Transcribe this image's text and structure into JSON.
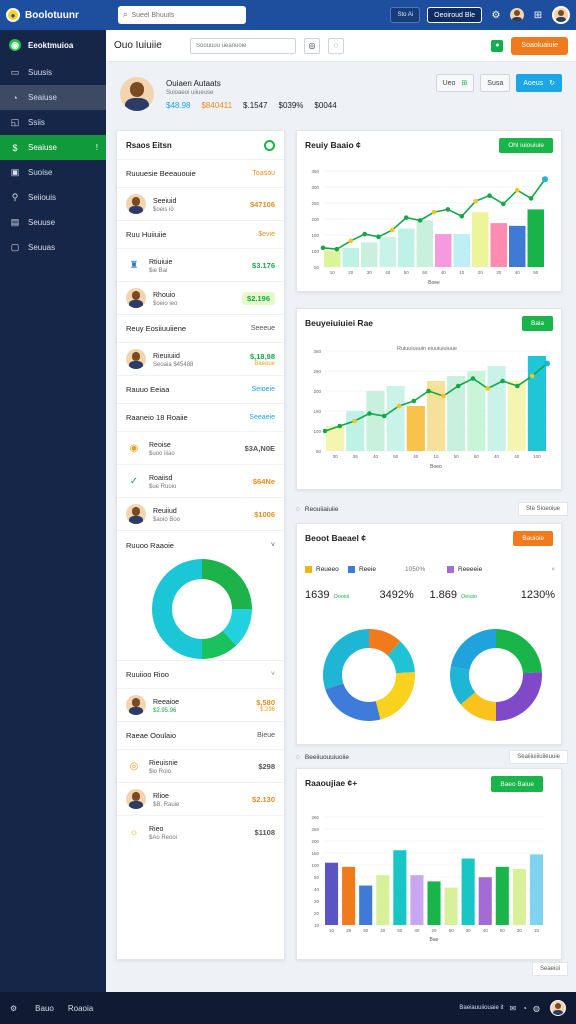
{
  "app": {
    "title": "Boolotuunr"
  },
  "search": {
    "placeholder": "Sueel Bhuuils",
    "icon": "search-icon"
  },
  "topbar": {
    "pill1": "Sto Ai",
    "pill2": "Oeoiroud Ble",
    "icons": [
      "settings-icon",
      "notification-icon",
      "user-avatar",
      "grid-icon"
    ]
  },
  "sidebar": {
    "items": [
      {
        "label": "Eeoktmuioa",
        "icon": "globe-icon",
        "state": "brand"
      },
      {
        "label": "Suusis",
        "icon": "chat-icon"
      },
      {
        "label": "Seaiuse",
        "icon": "refresh-icon",
        "state": "active"
      },
      {
        "label": "Ssiis",
        "icon": "bookmark-icon"
      },
      {
        "label": "Seaiuse",
        "icon": "dollar-icon",
        "state": "green",
        "badge": "!"
      },
      {
        "label": "Suoise",
        "icon": "wallet-icon"
      },
      {
        "label": "Seiiouis",
        "icon": "link-icon"
      },
      {
        "label": "Seuuse",
        "icon": "calendar-icon"
      },
      {
        "label": "Seuuas",
        "icon": "lock-icon"
      }
    ]
  },
  "subheader": {
    "title": "Ouo Iuiuiie",
    "search_placeholder": "Soouuuu ueanuoie",
    "btn_left": "◎",
    "btn_right": "◌",
    "action": "Soaoluaiuie"
  },
  "profile": {
    "name": "Ouiaen Autaats",
    "sub": "Suioaeoi uiiueuse",
    "stats": [
      {
        "label": "$48.98",
        "color": "#1ea3e6"
      },
      {
        "label": "$840411",
        "color": "#f08a1c"
      },
      {
        "label": "$.1547",
        "color": "#333333"
      },
      {
        "label": "$039%",
        "color": "#333333"
      },
      {
        "label": "$0044",
        "color": "#333333"
      }
    ],
    "btn1": "Ueo",
    "btn2": "Susa",
    "btn3": "Aoeus"
  },
  "leftpanel": {
    "header": "Rsaos Eitsn",
    "sections": [
      {
        "type": "sec",
        "label": "Ruuuesie Beeauouie",
        "right": "Toasou",
        "rcolor": "#f08a1c"
      },
      {
        "type": "row",
        "icon": "user-avatar",
        "name": "Seeiuid",
        "sub": "$oeis   iö",
        "val": "$47106",
        "vcolor": "#f08a1c"
      },
      {
        "type": "sec",
        "label": "Ruu Huiiuiie",
        "right": "$evie",
        "rcolor": "#f08a1c"
      },
      {
        "type": "row",
        "icon": "tower-icon",
        "name": "Rtiuiuie",
        "sub": "$ie  Bai",
        "val": "$3.176",
        "vcolor": "#18a844"
      },
      {
        "type": "row",
        "icon": "user-avatar",
        "name": "Rhouio",
        "sub": "$oeio ieo",
        "val": "$2.196",
        "vcolor": "#18a844",
        "badge": true
      },
      {
        "type": "sec",
        "label": "Reuy Eosiiuuiiene",
        "right": "Seeeue",
        "rcolor": "#555555"
      },
      {
        "type": "row",
        "icon": "user-avatar",
        "name": "Rieuiuiid",
        "sub": "Seoaia   $45488",
        "val": "$,18,98",
        "vcolor": "#18a844",
        "val2": "Baeoue",
        "v2color": "#f0a21c"
      },
      {
        "type": "sec",
        "label": "Rauuo Eeiaa",
        "right": "Seioeie",
        "rcolor": "#1ea3e6"
      },
      {
        "type": "sec",
        "label": "Raaneio 18 Roaiie",
        "right": "Seeaeie",
        "rcolor": "#1ea3e6"
      },
      {
        "type": "row",
        "icon": "coin-icon",
        "name": "Reoise",
        "sub": "$uoo  iiiao",
        "val": "$3A,N0E",
        "vcolor": "#555555"
      },
      {
        "type": "row",
        "icon": "check-icon",
        "name": "Roaiisd",
        "sub": "$ue   Ruoio",
        "val": "$64Ne",
        "vcolor": "#f08a1c"
      },
      {
        "type": "row",
        "icon": "user-avatar",
        "name": "Reuiiud",
        "sub": "$aoio  Boo",
        "val": "$1006",
        "vcolor": "#f08a1c"
      }
    ],
    "donut_title": "Ruuoo Raaoie",
    "donut_segments": [
      {
        "value": 25,
        "color": "#1db24a"
      },
      {
        "value": 13,
        "color": "#22d1de"
      },
      {
        "value": 12,
        "color": "#19c25c"
      },
      {
        "value": 50,
        "color": "#1bc6d6"
      }
    ],
    "lower": [
      {
        "type": "sec",
        "label": "Ruuiioo Rioo",
        "right": "˅",
        "rcolor": "#888888"
      },
      {
        "type": "row",
        "icon": "user-avatar",
        "name": "Reeaioe",
        "sub": "$2.95.96",
        "val": "$,580",
        "vcolor": "#f08a1c",
        "val2": "$.296",
        "v2color": "#f0a21c",
        "subcolor": "#18a844"
      },
      {
        "type": "sec",
        "label": "Raeae Ooulaio",
        "right": "Bieue",
        "rcolor": "#555555"
      },
      {
        "type": "row",
        "icon": "target-icon",
        "name": "Rieuisnie",
        "sub": "$lo  Roio",
        "val": "$298",
        "vcolor": "#555555"
      },
      {
        "type": "row",
        "icon": "user-avatar",
        "name": "Rlioe",
        "sub": "$B.   Rauie",
        "val": "$2.130",
        "vcolor": "#f08a1c"
      },
      {
        "type": "row",
        "icon": "lion-icon",
        "name": "Rieo",
        "sub": "$Ao  Reooi",
        "val": "$1108",
        "vcolor": "#555555"
      }
    ]
  },
  "cards": {
    "card1": {
      "title": "Reuiy Baaio ¢",
      "btn": "Ohl iuiouiuie",
      "btn_color": "#19b44a"
    },
    "card2": {
      "title": "Beuyeiuiuiei Rae",
      "btn": "Baia",
      "btn_color": "#19b44a",
      "note": "Ruiuuiuuuin eiuuiuiuiuue"
    },
    "strip1": {
      "label": "Reouiiaiuiie",
      "right": "Ste Sioeoiue"
    },
    "card3": {
      "title": "Beoot Baeael ¢",
      "btn": "Bauioie",
      "btn_color": "#f07a1c",
      "legend": [
        {
          "label": "Reueeo",
          "color": "#f0b21c"
        },
        {
          "label": "Reeie",
          "color": "#3f7bd8"
        },
        {
          "label": "1050%",
          "color": null
        },
        {
          "label": "Reeeeie",
          "color": "#a46bd4"
        }
      ],
      "values": [
        {
          "big": "1639",
          "small": "Oooioi",
          "color": "#19b44a"
        },
        {
          "big": "3492%",
          "small": "",
          "color": null
        },
        {
          "big": "1.869",
          "small": "Oeiuio",
          "color": "#19b44a"
        },
        {
          "big": "1230%",
          "small": "",
          "color": null
        }
      ],
      "close": "×"
    },
    "strip2": {
      "label": "Beeiiuouuiuoiie",
      "right": "Seaiiiuiiiuiieuuie"
    },
    "card4": {
      "title": "Raaoujiae ¢+",
      "btn": "Baeo Baiue",
      "btn_color": "#19b44a"
    },
    "strip3": {
      "right": "Seaeiui"
    }
  },
  "chart_data": [
    {
      "type": "line",
      "title": "Reuiy Baaio",
      "x": [
        "1M",
        "2M",
        "3M",
        "4M",
        "5M",
        "6M",
        "7M",
        "8M",
        "9M",
        "10M",
        "11M",
        "12M"
      ],
      "ylabels": [
        "350",
        "300",
        "250",
        "200",
        "150",
        "100",
        "50"
      ],
      "xlabels": [
        "10",
        "20",
        "30",
        "40",
        "50",
        "60",
        "40",
        "10",
        "20",
        "30",
        "40",
        "50"
      ],
      "xtitle": "Boee",
      "series": [
        {
          "values": [
            70,
            65,
            95,
            120,
            110,
            135,
            180,
            170,
            200,
            210,
            185,
            240,
            260,
            230,
            280,
            250,
            320
          ],
          "color": "#12a847"
        }
      ],
      "bars": [
        {
          "value": 60,
          "color": "#d9f49a"
        },
        {
          "value": 70,
          "color": "#bff2e6"
        },
        {
          "value": 90,
          "color": "#c8f0dd"
        },
        {
          "value": 110,
          "color": "#c9f2e8"
        },
        {
          "value": 140,
          "color": "#bff2e6"
        },
        {
          "value": 170,
          "color": "#c8f0dd"
        },
        {
          "value": 120,
          "color": "#f69ae0"
        },
        {
          "value": 120,
          "color": "#bdeff5"
        },
        {
          "value": 200,
          "color": "#ecf59a"
        },
        {
          "value": 160,
          "color": "#ff8bb0"
        },
        {
          "value": 150,
          "color": "#3f7ad6"
        },
        {
          "value": 210,
          "color": "#18b449"
        }
      ],
      "ylim": [
        0,
        350
      ]
    },
    {
      "type": "line",
      "title": "Beuyeiuiuiei Rae",
      "ylabels": [
        "350",
        "250",
        "200",
        "150",
        "100",
        "50"
      ],
      "xlabels": [
        "30",
        "36",
        "40",
        "50",
        "40",
        "10",
        "50",
        "50",
        "40",
        "40",
        "100"
      ],
      "xtitle": "Boeo",
      "series": [
        {
          "values": [
            40,
            50,
            60,
            75,
            70,
            90,
            100,
            120,
            110,
            130,
            145,
            125,
            140,
            130,
            150,
            175
          ],
          "color": "#12a847"
        }
      ],
      "bars": [
        {
          "value": 50,
          "color": "#f3f5b0"
        },
        {
          "value": 80,
          "color": "#bff2e6"
        },
        {
          "value": 120,
          "color": "#c8f0dd"
        },
        {
          "value": 130,
          "color": "#c9f2e8"
        },
        {
          "value": 90,
          "color": "#f9c24a"
        },
        {
          "value": 140,
          "color": "#f6e19a"
        },
        {
          "value": 150,
          "color": "#c8f0dd"
        },
        {
          "value": 160,
          "color": "#c8f4d8"
        },
        {
          "value": 170,
          "color": "#c9f2e8"
        },
        {
          "value": 140,
          "color": "#f3f5b0"
        },
        {
          "value": 190,
          "color": "#1fc6d6"
        }
      ],
      "ylim": [
        0,
        200
      ]
    },
    {
      "type": "pie",
      "slices": [
        {
          "value": 12,
          "color": "#f07a1c"
        },
        {
          "value": 12,
          "color": "#20c2d6"
        },
        {
          "value": 22,
          "color": "#f9d11f"
        },
        {
          "value": 24,
          "color": "#3f7bd8"
        },
        {
          "value": 30,
          "color": "#1fb6d6"
        }
      ]
    },
    {
      "type": "pie",
      "slices": [
        {
          "value": 24,
          "color": "#19b44a"
        },
        {
          "value": 26,
          "color": "#7f49c8"
        },
        {
          "value": 14,
          "color": "#f9c21c"
        },
        {
          "value": 14,
          "color": "#1fb6d6"
        },
        {
          "value": 22,
          "color": "#20a2dc"
        }
      ]
    },
    {
      "type": "bar",
      "title": "Raaoujiae",
      "ylabels": [
        "260",
        "250",
        "200",
        "150",
        "100",
        "50",
        "40",
        "30",
        "20",
        "10"
      ],
      "xlabels": [
        "10",
        "28",
        "30",
        "40",
        "50",
        "40",
        "20",
        "50",
        "30",
        "40",
        "50",
        "30",
        "10"
      ],
      "xtitle": "Bae",
      "values": [
        150,
        140,
        95,
        120,
        180,
        120,
        105,
        90,
        160,
        115,
        140,
        135,
        170
      ],
      "colors": [
        "#5a55c2",
        "#f07a1c",
        "#3f7ad6",
        "#d8f09a",
        "#19c6c6",
        "#c9a6f0",
        "#19b44a",
        "#d8f09a",
        "#19c6c6",
        "#a46bd4",
        "#19b44a",
        "#d8f09a",
        "#7fd2f0"
      ],
      "ylim": [
        0,
        260
      ]
    }
  ],
  "footer": {
    "left": "Bauo",
    "left2": "Roaoia",
    "right": "Baeiauuiiouaie it",
    "icons": [
      "gear-icon",
      "mail-icon",
      "bell-icon",
      "globe-icon",
      "user-avatar"
    ]
  }
}
